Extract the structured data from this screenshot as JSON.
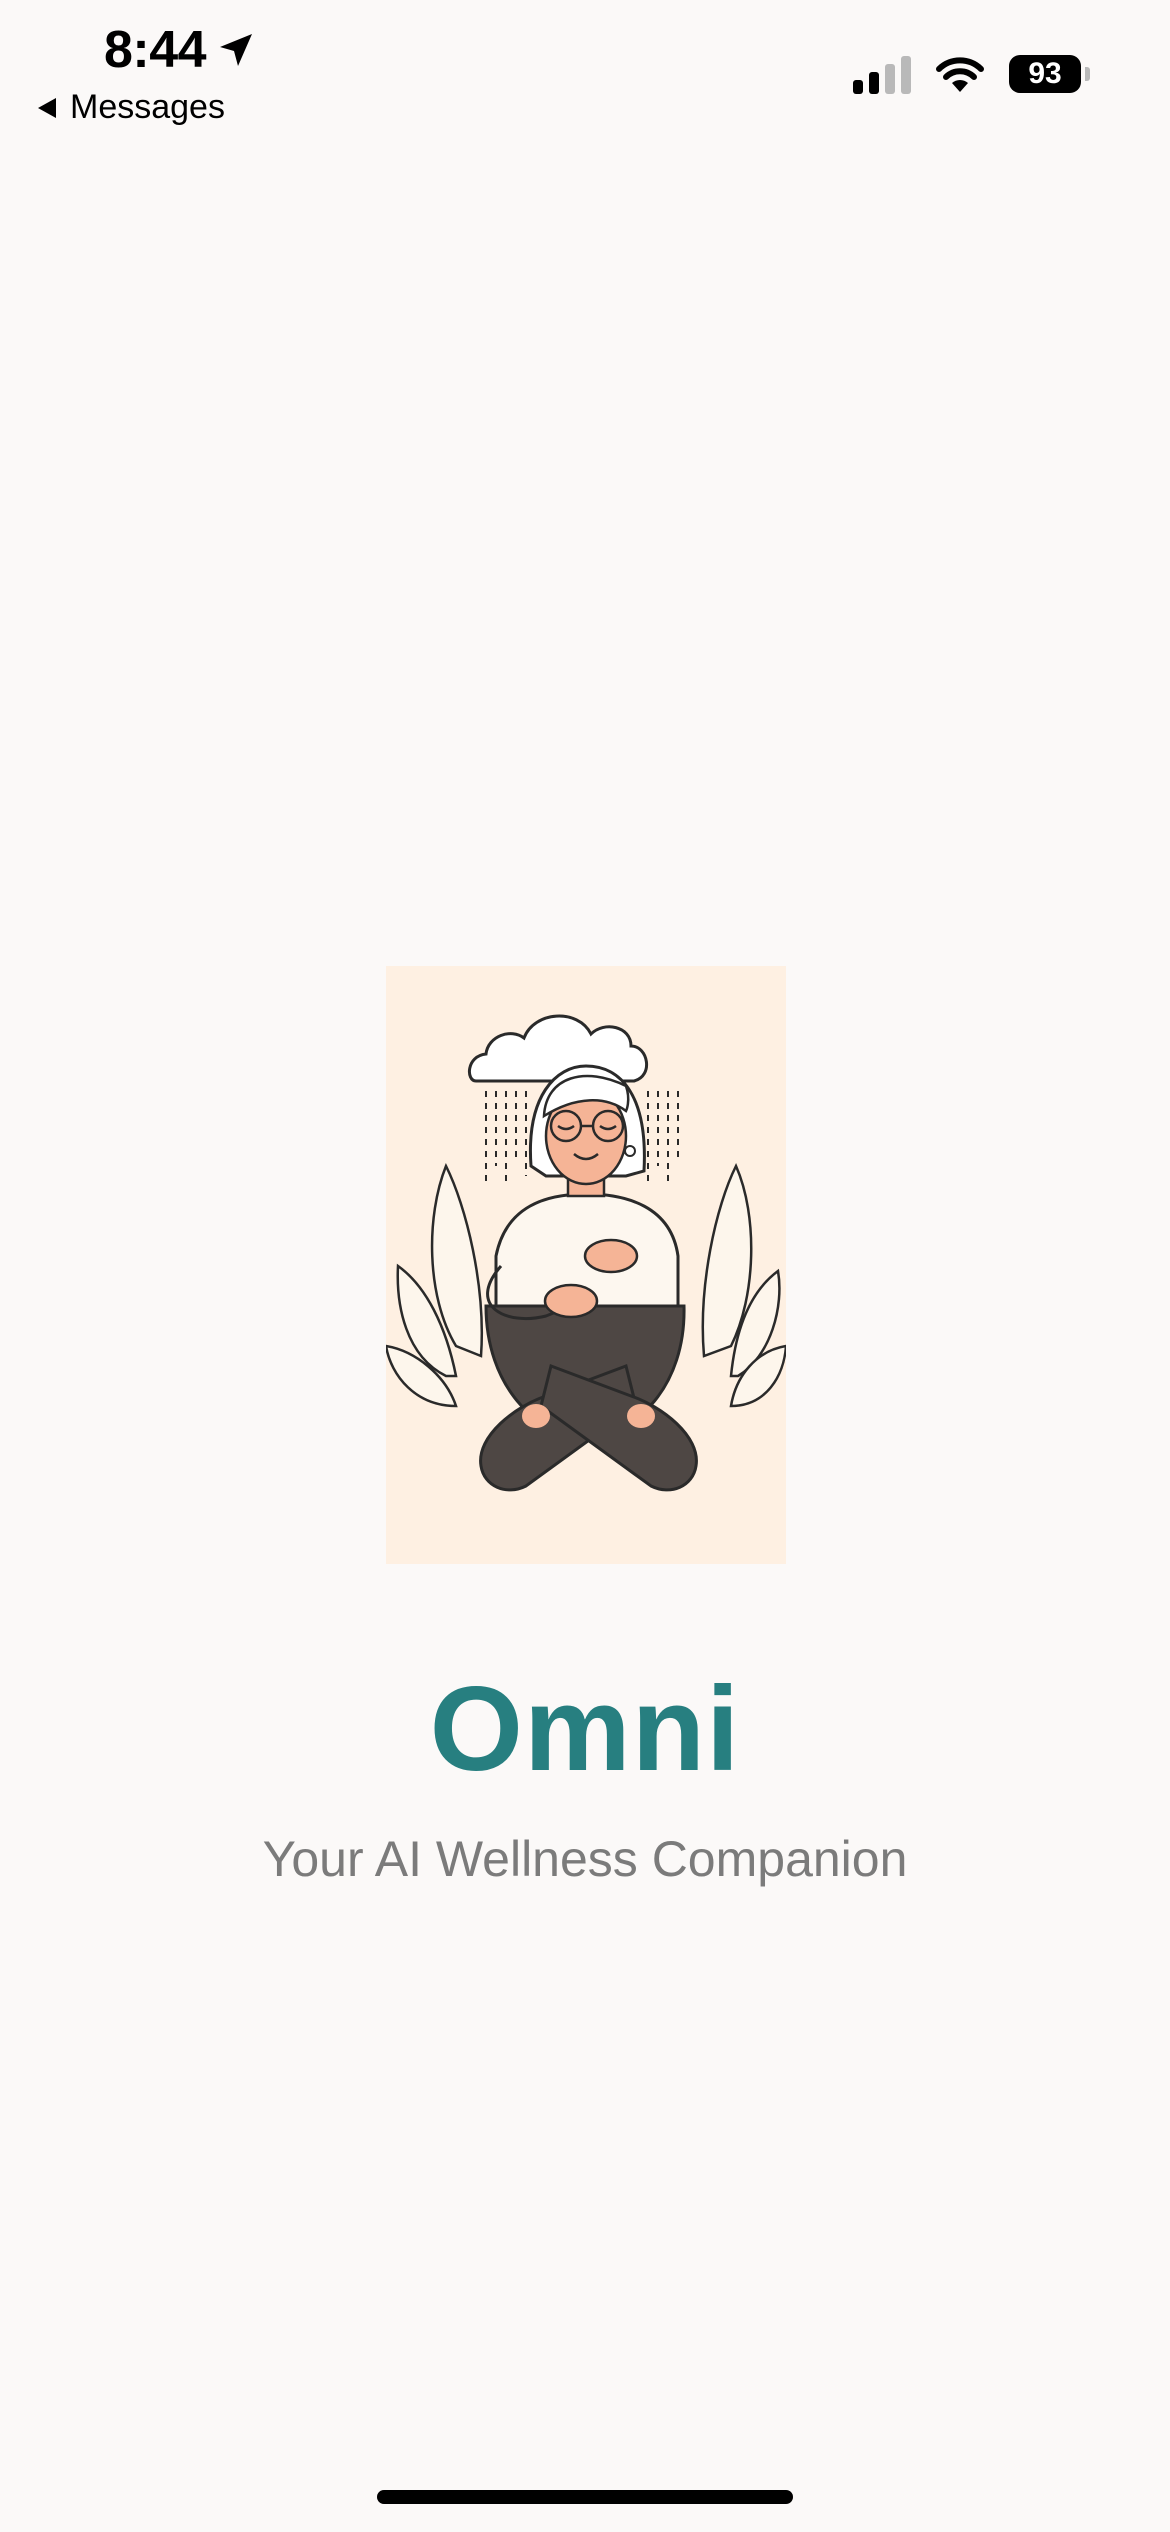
{
  "status_bar": {
    "time": "8:44",
    "back_label": "Messages",
    "battery_level": "93",
    "signal_bars_active": 2,
    "signal_bars_total": 4
  },
  "splash": {
    "title": "Omni",
    "subtitle": "Your AI Wellness Companion",
    "illustration_icon": "meditating-person-rain-cloud-illustration"
  },
  "colors": {
    "background": "#fbf9f8",
    "title": "#277f80",
    "subtitle": "#7b7b7b",
    "illustration_bg": "#fef0e2",
    "skin": "#f5b496",
    "pants": "#4e4744"
  }
}
